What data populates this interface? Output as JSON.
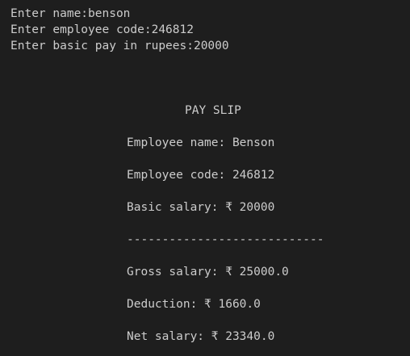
{
  "terminal": {
    "input_lines": [
      "Enter name:benson",
      "Enter employee code:246812",
      "Enter basic pay in rupees:20000"
    ],
    "payslip": {
      "title": "PAY SLIP",
      "employee_name": "Employee name: Benson",
      "employee_code": "Employee code: 246812",
      "basic_salary": "Basic salary: ₹ 20000",
      "separator": "----------------------------",
      "gross_salary": "Gross salary: ₹ 25000.0",
      "deduction": "Deduction: ₹ 1660.0",
      "net_salary": "Net salary: ₹ 23340.0"
    }
  },
  "colors": {
    "background": "#1e1e1e",
    "text": "#cccccc"
  }
}
